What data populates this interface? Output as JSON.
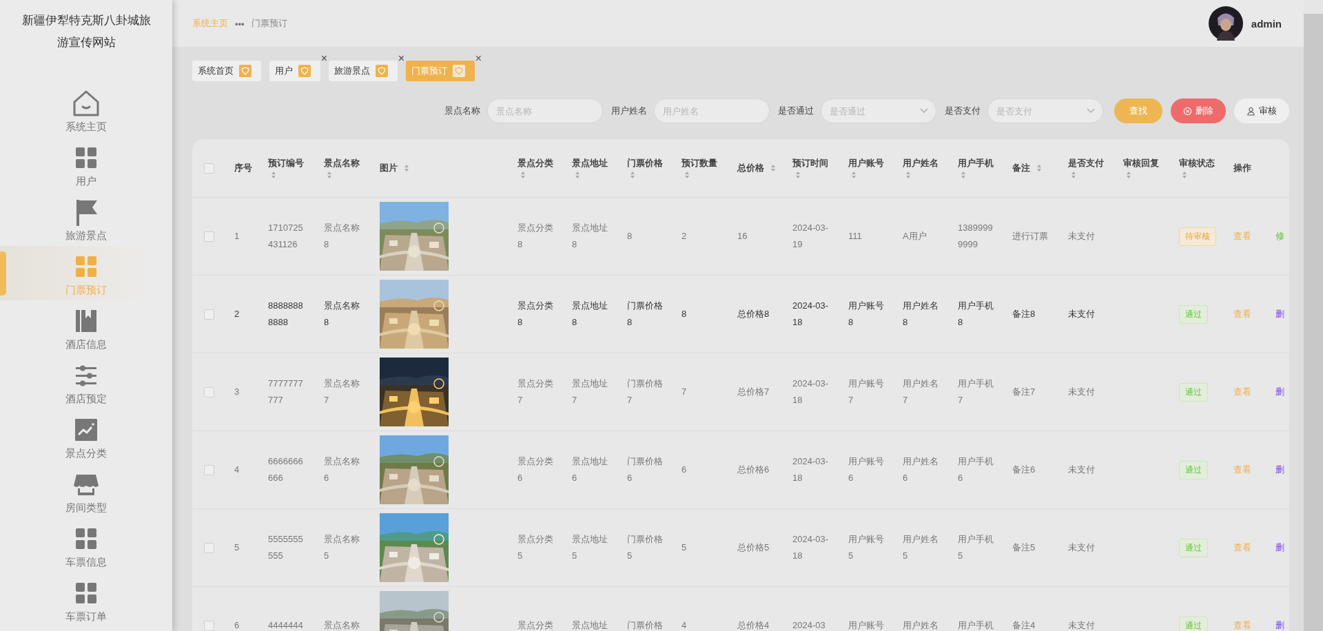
{
  "sidebar": {
    "title": "新疆伊犁特克斯八卦城旅游宣传网站",
    "items": [
      {
        "label": "系统主页",
        "kind": "house",
        "selected": false
      },
      {
        "label": "用户",
        "kind": "grid",
        "selected": false
      },
      {
        "label": "旅游景点",
        "kind": "flag",
        "selected": false
      },
      {
        "label": "门票预订",
        "kind": "grid",
        "selected": true
      },
      {
        "label": "酒店信息",
        "kind": "book",
        "selected": false
      },
      {
        "label": "酒店预定",
        "kind": "sliders",
        "selected": false
      },
      {
        "label": "景点分类",
        "kind": "chart",
        "selected": false
      },
      {
        "label": "房间类型",
        "kind": "store",
        "selected": false
      },
      {
        "label": "车票信息",
        "kind": "grid",
        "selected": false
      },
      {
        "label": "车票订单",
        "kind": "grid",
        "selected": false
      }
    ]
  },
  "breadcrumb": {
    "items": [
      "系统主页",
      "门票预订"
    ],
    "separator": "•••"
  },
  "user": {
    "name": "admin"
  },
  "tabs": [
    {
      "label": "系统首页",
      "selected": false
    },
    {
      "label": "用户",
      "selected": false,
      "close": "×"
    },
    {
      "label": "旅游景点",
      "selected": false,
      "close": "×"
    },
    {
      "label": "门票预订",
      "selected": true,
      "close": "×"
    }
  ],
  "filters": [
    {
      "label": "景点名称",
      "kind": "input",
      "placeholder": "景点名称"
    },
    {
      "label": "用户姓名",
      "kind": "input",
      "placeholder": "用户姓名"
    },
    {
      "label": "是否通过",
      "kind": "select",
      "placeholder": "是否通过"
    },
    {
      "label": "是否支付",
      "kind": "select",
      "placeholder": "是否支付"
    }
  ],
  "buttons": [
    {
      "label": "查找",
      "kind": "search"
    },
    {
      "label": "删除",
      "kind": "delete"
    },
    {
      "label": "审核",
      "kind": "review"
    }
  ],
  "table": {
    "all_checked": false,
    "columns": [
      {
        "label": "序号",
        "sortable": false
      },
      {
        "label": "预订编号",
        "sortable": true
      },
      {
        "label": "景点名称",
        "sortable": true
      },
      {
        "label": "图片",
        "sortable": true
      },
      {
        "label": "景点分类",
        "sortable": true
      },
      {
        "label": "景点地址",
        "sortable": true
      },
      {
        "label": "门票价格",
        "sortable": true
      },
      {
        "label": "预订数量",
        "sortable": true
      },
      {
        "label": "总价格",
        "sortable": true
      },
      {
        "label": "预订时间",
        "sortable": true
      },
      {
        "label": "用户账号",
        "sortable": true
      },
      {
        "label": "用户姓名",
        "sortable": true
      },
      {
        "label": "用户手机",
        "sortable": true
      },
      {
        "label": "备注",
        "sortable": true
      },
      {
        "label": "是否支付",
        "sortable": true
      },
      {
        "label": "审核回复",
        "sortable": true
      },
      {
        "label": "审核状态",
        "sortable": true
      },
      {
        "label": "操作",
        "sortable": false
      }
    ],
    "rows": [
      {
        "checked": false,
        "highlighted": false,
        "no": "1",
        "id": "1710725431126",
        "name": "景点名称8",
        "category": "景点分类8",
        "address": "景点地址8",
        "price": "8",
        "quantity": "2",
        "total": "16",
        "time": "2024-03-19",
        "account": "111",
        "username": "A用户",
        "phone": "13899999999",
        "note": "进行订票",
        "paid": "未支付",
        "status": {
          "label": "待审核",
          "kind": "pending"
        },
        "actions": [
          {
            "label": "查看",
            "kind": "view"
          },
          {
            "label": "修",
            "kind": "edit"
          }
        ]
      },
      {
        "checked": false,
        "highlighted": true,
        "no": "2",
        "id": "88888888888",
        "name": "景点名称8",
        "category": "景点分类8",
        "address": "景点地址8",
        "price": "门票价格8",
        "quantity": "8",
        "total": "总价格8",
        "time": "2024-03-18",
        "account": "用户账号8",
        "username": "用户姓名8",
        "phone": "用户手机8",
        "note": "备注8",
        "paid": "未支付",
        "status": {
          "label": "通过",
          "kind": "passed"
        },
        "actions": [
          {
            "label": "查看",
            "kind": "view"
          },
          {
            "label": "删",
            "kind": "delete"
          }
        ]
      },
      {
        "checked": false,
        "highlighted": false,
        "no": "3",
        "id": "7777777777",
        "name": "景点名称7",
        "category": "景点分类7",
        "address": "景点地址7",
        "price": "门票价格7",
        "quantity": "7",
        "total": "总价格7",
        "time": "2024-03-18",
        "account": "用户账号7",
        "username": "用户姓名7",
        "phone": "用户手机7",
        "note": "备注7",
        "paid": "未支付",
        "status": {
          "label": "通过",
          "kind": "passed"
        },
        "actions": [
          {
            "label": "查看",
            "kind": "view"
          },
          {
            "label": "删",
            "kind": "delete"
          }
        ]
      },
      {
        "checked": false,
        "highlighted": false,
        "no": "4",
        "id": "6666666666",
        "name": "景点名称6",
        "category": "景点分类6",
        "address": "景点地址6",
        "price": "门票价格6",
        "quantity": "6",
        "total": "总价格6",
        "time": "2024-03-18",
        "account": "用户账号6",
        "username": "用户姓名6",
        "phone": "用户手机6",
        "note": "备注6",
        "paid": "未支付",
        "status": {
          "label": "通过",
          "kind": "passed"
        },
        "actions": [
          {
            "label": "查看",
            "kind": "view"
          },
          {
            "label": "删",
            "kind": "delete"
          }
        ]
      },
      {
        "checked": false,
        "highlighted": false,
        "no": "5",
        "id": "5555555555",
        "name": "景点名称5",
        "category": "景点分类5",
        "address": "景点地址5",
        "price": "门票价格5",
        "quantity": "5",
        "total": "总价格5",
        "time": "2024-03-18",
        "account": "用户账号5",
        "username": "用户姓名5",
        "phone": "用户手机5",
        "note": "备注5",
        "paid": "未支付",
        "status": {
          "label": "通过",
          "kind": "passed"
        },
        "actions": [
          {
            "label": "查看",
            "kind": "view"
          },
          {
            "label": "删",
            "kind": "delete"
          }
        ]
      },
      {
        "checked": false,
        "highlighted": false,
        "no": "6",
        "id": "4444444",
        "name": "景点名称",
        "category": "景点分类",
        "address": "景点地址",
        "price": "门票价格",
        "quantity": "4",
        "total": "总价格4",
        "time": "2024-03",
        "account": "用户账号",
        "username": "用户姓名",
        "phone": "用户手机",
        "note": "备注4",
        "paid": "未支付",
        "status": {
          "label": "通过",
          "kind": "passed"
        },
        "actions": [
          {
            "label": "查看",
            "kind": "view"
          },
          {
            "label": "删",
            "kind": "delete"
          }
        ]
      }
    ]
  }
}
